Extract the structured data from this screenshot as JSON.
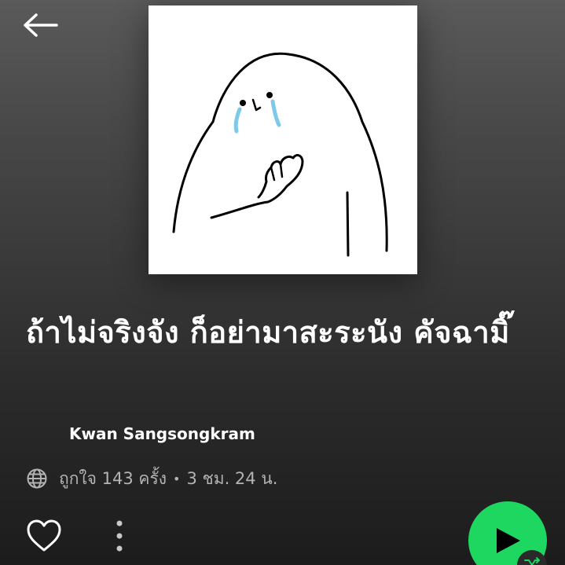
{
  "header": {
    "back_icon": "arrow-left-icon"
  },
  "cover": {
    "icon": "crying-ghost-illustration",
    "background": "#ffffff",
    "tear_color": "#7ec8e8"
  },
  "playlist": {
    "title": "ถ้าไม่จริงจัง ก็อย่ามาสะระนัง คัจฉามิ๊",
    "owner": "Kwan Sangsongkram",
    "visibility_icon": "globe-icon",
    "likes": "ถูกใจ 143 ครั้ง",
    "separator": "•",
    "duration": "3 ชม. 24 น."
  },
  "actions": {
    "like_icon": "heart-outline-icon",
    "more_icon": "more-vertical-icon",
    "play_icon": "play-icon",
    "shuffle_icon": "shuffle-icon"
  },
  "colors": {
    "accent": "#1ed760",
    "text_primary": "#ffffff",
    "text_secondary": "#b3b3b3"
  }
}
